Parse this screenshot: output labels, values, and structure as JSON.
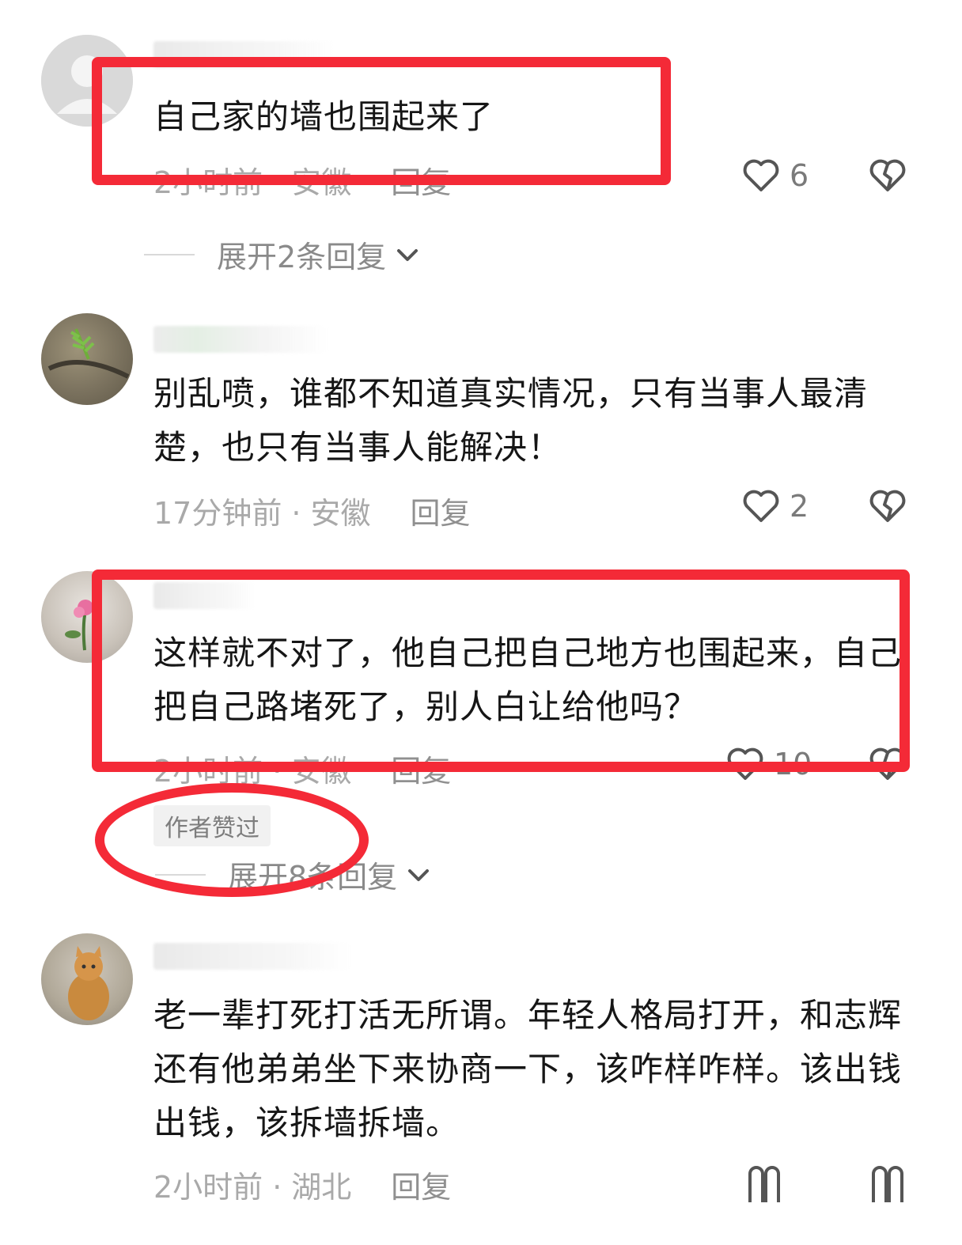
{
  "comments": [
    {
      "text": "自己家的墙也围起来了",
      "time": "2小时前",
      "location": "安徽",
      "reply_label": "回复",
      "likes": "6",
      "expand_label": "展开2条回复"
    },
    {
      "text": "别乱喷，谁都不知道真实情况，只有当事人最清楚，也只有当事人能解决！",
      "time": "17分钟前",
      "location": "安徽",
      "reply_label": "回复",
      "likes": "2"
    },
    {
      "text": "这样就不对了，他自己把自己地方也围起来，自己把自己路堵死了，别人白让给他吗？",
      "time": "2小时前",
      "location": "安徽",
      "reply_label": "回复",
      "likes": "10",
      "badge": "作者赞过",
      "expand_label": "展开8条回复"
    },
    {
      "text": "老一辈打死打活无所谓。年轻人格局打开，和志辉还有他弟弟坐下来协商一下，该咋样咋样。该出钱出钱，该拆墙拆墙。",
      "time": "2小时前",
      "location": "湖北",
      "reply_label": "回复"
    }
  ],
  "icons": {
    "like": "heart-outline-icon",
    "dislike": "broken-heart-icon",
    "expand": "chevron-down-icon"
  },
  "colors": {
    "annotation": "#f42a37",
    "meta_text": "#a9a9a9"
  }
}
